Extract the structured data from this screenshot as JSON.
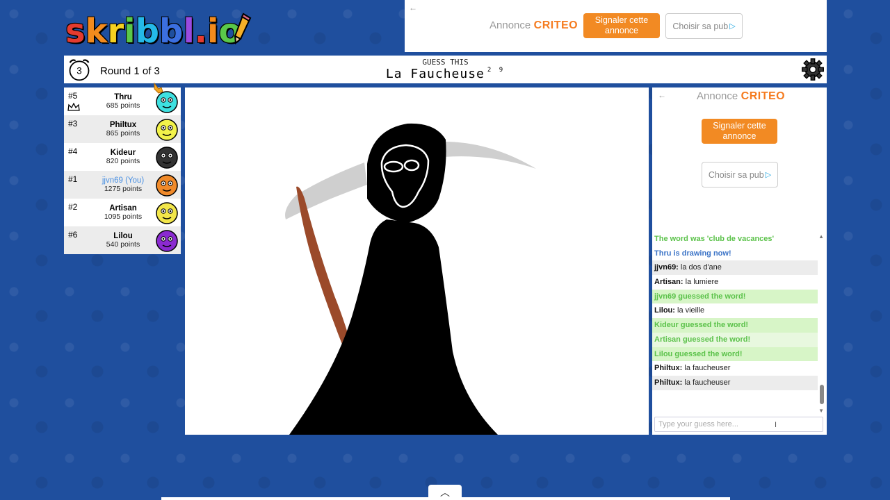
{
  "logo": {
    "letters": [
      "s",
      "k",
      "r",
      "i",
      "b",
      "b",
      "l",
      ".",
      "i",
      "o"
    ],
    "colors": [
      "#e43b2f",
      "#f38b1d",
      "#f5d020",
      "#5ac84a",
      "#24b9e8",
      "#3b6fe0",
      "#9a4ae0",
      "#e43b2f",
      "#f38b1d",
      "#5ac84a"
    ]
  },
  "ad_top": {
    "annonce": "Annonce",
    "brand": "CRITEO",
    "report": "Signaler cette annonce",
    "choose": "Choisir sa pub",
    "back": "←"
  },
  "header": {
    "timer": "3",
    "round": "Round 1 of 3",
    "guess_label": "GUESS THIS",
    "word": "La Faucheuse",
    "word_lengths": "2 9"
  },
  "players": [
    {
      "rank": "#5",
      "name": "Thru",
      "points": "685 points",
      "avatar_color": "#3ee0e0",
      "you": false,
      "crown": true,
      "drawing": true
    },
    {
      "rank": "#3",
      "name": "Philtux",
      "points": "865 points",
      "avatar_color": "#f2f24a",
      "you": false
    },
    {
      "rank": "#4",
      "name": "Kideur",
      "points": "820 points",
      "avatar_color": "#333333",
      "you": false
    },
    {
      "rank": "#1",
      "name": "jjvn69 (You)",
      "points": "1275 points",
      "avatar_color": "#f08a2a",
      "you": true
    },
    {
      "rank": "#2",
      "name": "Artisan",
      "points": "1095 points",
      "avatar_color": "#f2e64a",
      "you": false
    },
    {
      "rank": "#6",
      "name": "Lilou",
      "points": "540 points",
      "avatar_color": "#8a2ad0",
      "you": false
    }
  ],
  "side_ad": {
    "annonce": "Annonce",
    "brand": "CRITEO",
    "report": "Signaler cette annonce",
    "choose": "Choisir sa pub",
    "back": "←"
  },
  "chat": [
    {
      "type": "green",
      "text": "The word was 'club de vacances'"
    },
    {
      "type": "blue",
      "text": "Thru is drawing now!"
    },
    {
      "type": "msg",
      "who": "jjvn69:",
      "text": " la dos d'ane",
      "alt": true
    },
    {
      "type": "msg",
      "who": "Artisan:",
      "text": " la lumiere",
      "alt": false
    },
    {
      "type": "greenbg",
      "text": "jjvn69 guessed the word!"
    },
    {
      "type": "msg",
      "who": "Lilou:",
      "text": " la vieille",
      "alt": false
    },
    {
      "type": "greenbg",
      "text": "Kideur guessed the word!"
    },
    {
      "type": "greenbg2",
      "text": "Artisan guessed the word!"
    },
    {
      "type": "greenbg",
      "text": "Lilou guessed the word!"
    },
    {
      "type": "msg",
      "who": "Philtux:",
      "text": " la faucheuser",
      "alt": false
    },
    {
      "type": "msg",
      "who": "Philtux:",
      "text": " la faucheuser",
      "alt": true
    }
  ],
  "input": {
    "placeholder": "Type your guess here..."
  },
  "colors": {
    "background": "#1f4f9e",
    "criteo_orange": "#f57b1f",
    "guess_green": "#5bc24a",
    "you_blue": "#4a90e2"
  }
}
